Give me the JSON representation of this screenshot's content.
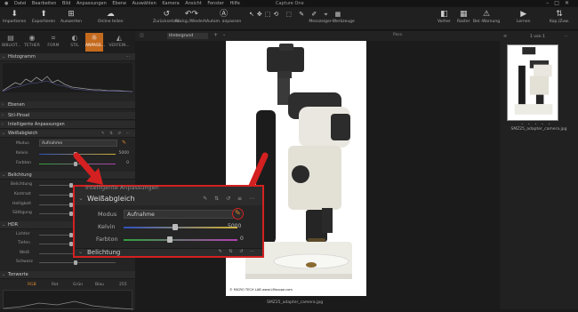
{
  "menu": {
    "items": [
      "Datei",
      "Bearbeiten",
      "Bild",
      "Anpassungen",
      "Ebene",
      "Auswählen",
      "Kamera",
      "Ansicht",
      "Fenster",
      "Hilfe"
    ],
    "app_title": "Capture One"
  },
  "toolbar": {
    "importieren": "Importieren",
    "exportieren": "Exportieren",
    "auswerten": "Auswerten",
    "online_teilen": "Online teilen",
    "zuruecksetzen": "Zurücksetzen",
    "rueckg": "Rückg./Wiederh.",
    "autom": "Autom. anpassen",
    "messzeiger": "Messzeiger-Werkzeuge",
    "vorher": "Vorher",
    "raster": "Raster",
    "bel_warnung": "Bel.-Warnung",
    "lernen": "Lernen",
    "kop_zuw": "Kop./Zuw."
  },
  "tool_tabs": [
    "BIBLIOT...",
    "TETHER",
    "FORM",
    "STIL",
    "ANPASS...",
    "VERFEIN..."
  ],
  "sections": {
    "histogramm": "Histogramm",
    "ebenen": "Ebenen",
    "stil_pinsel": "Stil-Pinsel",
    "intelligente": "Intelligente Anpassungen",
    "weissabgleich": "Weißabgleich",
    "belichtung": "Belichtung",
    "hdr": "HDR",
    "tonwerte": "Tonwerte"
  },
  "wb": {
    "modus_label": "Modus",
    "modus_value": "Aufnahme",
    "kelvin_label": "Kelvin",
    "kelvin_value": "5000",
    "farbton_label": "Farbton",
    "farbton_value": "0"
  },
  "belichtung_rows": [
    "Belichtung",
    "Kontrast",
    "Helligkeit",
    "Sättigung"
  ],
  "hdr_rows": [
    "Lichter",
    "Tiefen",
    "Weiß",
    "Schwarz"
  ],
  "tonwerte_tabs": [
    "RGB",
    "Rot",
    "Grün",
    "Blau"
  ],
  "tonwerte_max": "255",
  "viewer": {
    "layer_select": "Hintergrund",
    "caption": "SMZ25_adapter_camera.jpg",
    "photo_credit": "© MICRO TECH LAB  www.LMscope.com"
  },
  "browser": {
    "pass_label": "Pass.",
    "counter": "1 von 1",
    "thumb_caption": "SMZ25_adapter_camera.jpg"
  },
  "callout": {
    "partial_header": "Intelligente Anpassungen",
    "title": "Weißabgleich",
    "modus_label": "Modus",
    "modus_value": "Aufnahme",
    "kelvin_label": "Kelvin",
    "kelvin_value": "5000",
    "farbton_label": "Farbton",
    "farbton_value": "0",
    "next_title": "Belichtung"
  },
  "colors": {
    "accent": "#c46a1e",
    "highlight": "#d42020"
  }
}
